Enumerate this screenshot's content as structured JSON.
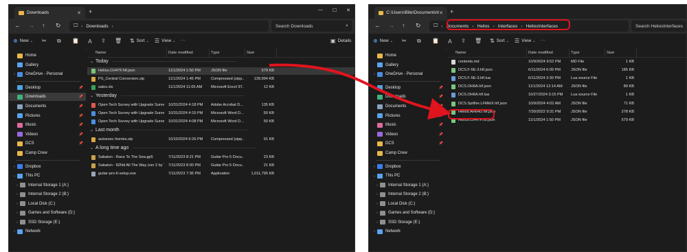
{
  "colors": {
    "folder": "#e8b84a",
    "json": "#7bc67e",
    "word": "#4a8fe3",
    "excel": "#3aa15a",
    "pdf": "#e05a4e",
    "lua": "#6b9bdb",
    "md": "#d8d8d8",
    "zip": "#d9a842",
    "accent": "#e0141e"
  },
  "left": {
    "tab_title": "Downloads",
    "address": [
      "Downloads"
    ],
    "search_placeholder": "Search Downloads",
    "toolbar": {
      "new": "New",
      "sort": "Sort",
      "view": "View",
      "more": "···",
      "details": "Details"
    },
    "sidebar": [
      {
        "label": "Home",
        "icon": "home-icon",
        "selected": false,
        "pin": false
      },
      {
        "label": "Gallery",
        "icon": "gallery-icon",
        "selected": false,
        "pin": false
      },
      {
        "label": "OneDrive - Personal",
        "icon": "cloud-icon",
        "selected": false,
        "pin": false,
        "chev": true
      },
      {
        "label": "Desktop",
        "icon": "desktop-icon",
        "selected": false,
        "pin": true
      },
      {
        "label": "Downloads",
        "icon": "download-icon",
        "selected": true,
        "pin": true
      },
      {
        "label": "Documents",
        "icon": "document-icon",
        "selected": false,
        "pin": true
      },
      {
        "label": "Pictures",
        "icon": "picture-icon",
        "selected": false,
        "pin": true
      },
      {
        "label": "Music",
        "icon": "music-icon",
        "selected": false,
        "pin": true
      },
      {
        "label": "Videos",
        "icon": "video-icon",
        "selected": false,
        "pin": true
      },
      {
        "label": "DCS",
        "icon": "folder-icon",
        "selected": false,
        "pin": true
      },
      {
        "label": "Camp Crew",
        "icon": "folder-icon",
        "selected": false,
        "pin": false
      },
      {
        "label": "Dropbox",
        "icon": "dropbox-icon",
        "selected": false,
        "pin": false,
        "chev": true
      },
      {
        "label": "This PC",
        "icon": "pc-icon",
        "selected": false,
        "pin": false,
        "chev": true,
        "open": true
      },
      {
        "label": "Internal Storage 1 (A:)",
        "icon": "drive-icon",
        "selected": false,
        "pin": false,
        "chev": true,
        "indent": true
      },
      {
        "label": "Internal Storage 2 (B:)",
        "icon": "drive-icon",
        "selected": false,
        "pin": false,
        "chev": true,
        "indent": true
      },
      {
        "label": "Local Disk (C:)",
        "icon": "drive-icon",
        "selected": false,
        "pin": false,
        "chev": true,
        "indent": true
      },
      {
        "label": "Games and Software (D:)",
        "icon": "drive-icon",
        "selected": false,
        "pin": false,
        "chev": true,
        "indent": true
      },
      {
        "label": "SSD Storage (E:)",
        "icon": "drive-icon",
        "selected": false,
        "pin": false,
        "chev": true,
        "indent": true
      },
      {
        "label": "Network",
        "icon": "network-icon",
        "selected": false,
        "pin": false,
        "chev": true
      }
    ],
    "columns": [
      "Name",
      "Date modified",
      "Type",
      "Size"
    ],
    "groups": [
      {
        "label": "Today",
        "rows": [
          {
            "name": "Helios.CH47F.hlf.json",
            "date": "11/1/2024 1:50 PM",
            "type": "JSON file",
            "size": "579 KB",
            "kind": "json",
            "selected": true
          },
          {
            "name": "PS_Central Conversion.zip",
            "date": "11/1/2024 1:45 PM",
            "type": "Compressed (zipp...",
            "size": "139,994 KB",
            "kind": "zip"
          },
          {
            "name": "sales.xls",
            "date": "11/1/2024 11:05 AM",
            "type": "Microsoft Excel 97...",
            "size": "12 KB",
            "kind": "excel"
          }
        ]
      },
      {
        "label": "Yesterday",
        "rows": [
          {
            "name": "Open Tech Survey with Upgrade Survey (...",
            "date": "10/31/2024 4:18 PM",
            "type": "Adobe Acrobat D...",
            "size": "135 KB",
            "kind": "pdf"
          },
          {
            "name": "Open Tech Survey with Upgrade Survey (...",
            "date": "10/31/2024 4:15 PM",
            "type": "Microsoft Word D...",
            "size": "50 KB",
            "kind": "word"
          },
          {
            "name": "Open Tech Survey with Upgrade Survey.d...",
            "date": "10/31/2024 4:08 PM",
            "type": "Microsoft Word D...",
            "size": "50 KB",
            "kind": "word"
          }
        ]
      },
      {
        "label": "Last month",
        "rows": [
          {
            "name": "autoexec liveries.zip",
            "date": "10/10/2024 6:26 PM",
            "type": "Compressed (zipp...",
            "size": "91 KB",
            "kind": "zip"
          }
        ]
      },
      {
        "label": "A long time ago",
        "rows": [
          {
            "name": "Sabaton - Race To The Sea.gp5",
            "date": "7/11/2023 8:21 PM",
            "type": "Guitar Pro 5 Docu...",
            "size": "23 KB",
            "kind": "gp"
          },
          {
            "name": "Sabaton - 82Nd All The Way (ver 2 by Ten...",
            "date": "7/11/2023 8:00 PM",
            "type": "Guitar Pro 5 Docu...",
            "size": "21 KB",
            "kind": "gp"
          },
          {
            "name": "guitar-pro-6-setup.exe",
            "date": "7/11/2023 7:36 PM",
            "type": "Application",
            "size": "1,011,795 KB",
            "kind": "exe"
          }
        ]
      }
    ]
  },
  "right": {
    "tab_title": "C:\\Users\\Bite\\Documents\\Hel",
    "address": [
      "Documents",
      "Helios",
      "Interfaces",
      "HeliosInterfaces"
    ],
    "search_placeholder": "Search HeliosInterfaces",
    "toolbar": {
      "new": "New",
      "sort": "Sort",
      "view": "View",
      "more": "···"
    },
    "columns": [
      "Name",
      "Date modified",
      "Type",
      "Size"
    ],
    "rows": [
      {
        "name": "contents.md",
        "date": "10/9/2024 9:52 PM",
        "type": "MD File",
        "size": "1 KB",
        "kind": "md"
      },
      {
        "name": "DCS.F-5E-3.hlf.json",
        "date": "6/11/2024 6:09 PM",
        "type": "JSON file",
        "size": "185 KB",
        "kind": "json"
      },
      {
        "name": "DCS.F-5E-3.hlf.lua",
        "date": "6/11/2024 3:30 PM",
        "type": "Lua source File",
        "size": "1 KB",
        "kind": "lua"
      },
      {
        "name": "DCS.OH6A.hlf.json",
        "date": "11/1/2024 12:14 AM",
        "type": "JSON file",
        "size": "89 KB",
        "kind": "json"
      },
      {
        "name": "DCS.OH6A.hlf.lua",
        "date": "10/27/2024 3:15 PM",
        "type": "Lua source File",
        "size": "1 KB",
        "kind": "lua"
      },
      {
        "name": "DCS.Spitfire.LFMkIX.hlf.json",
        "date": "10/9/2024 4:02 AM",
        "type": "JSON file",
        "size": "71 KB",
        "kind": "json"
      },
      {
        "name": "Helios.AH64D.hlf.json",
        "date": "7/30/2022 9:31 PM",
        "type": "JSON file",
        "size": "278 KB",
        "kind": "json"
      },
      {
        "name": "Helios.CH47F.hlf.json",
        "date": "11/1/2024 1:50 PM",
        "type": "JSON file",
        "size": "579 KB",
        "kind": "json"
      }
    ]
  }
}
